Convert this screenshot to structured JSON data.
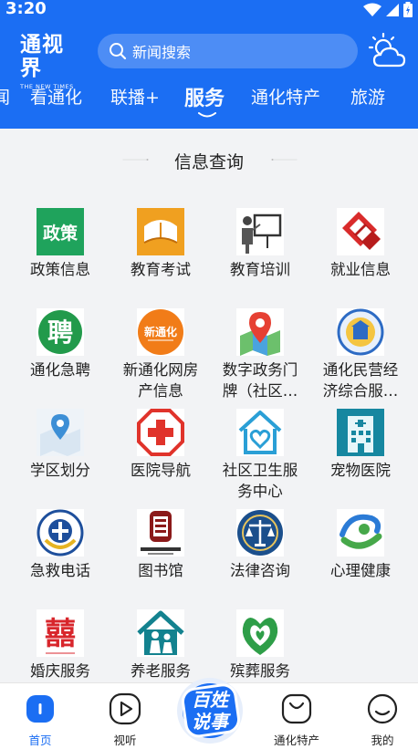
{
  "status": {
    "time": "3:20"
  },
  "header": {
    "logo_main": "通视界",
    "logo_sub": "THE NEW TIMES",
    "search_placeholder": "新闻搜索"
  },
  "tabs": [
    {
      "label": "闻"
    },
    {
      "label": "看通化"
    },
    {
      "label": "联播+"
    },
    {
      "label": "服务"
    },
    {
      "label": "通化特产"
    },
    {
      "label": "旅游"
    }
  ],
  "section": {
    "title": "信息查询"
  },
  "services": [
    {
      "label": "政策信息",
      "icon": "policy-icon"
    },
    {
      "label": "教育考试",
      "icon": "book-icon"
    },
    {
      "label": "教育培训",
      "icon": "teacher-icon"
    },
    {
      "label": "就业信息",
      "icon": "employment-icon"
    },
    {
      "label": "通化急聘",
      "icon": "hiring-icon"
    },
    {
      "label": "新通化网房\n产信息",
      "icon": "real-estate-icon"
    },
    {
      "label": "数字政务门\n牌（社区…",
      "icon": "map-pin-icon"
    },
    {
      "label": "通化民营经\n济综合服…",
      "icon": "economy-icon"
    },
    {
      "label": "学区划分",
      "icon": "school-district-icon"
    },
    {
      "label": "医院导航",
      "icon": "hospital-icon"
    },
    {
      "label": "社区卫生服\n务中心",
      "icon": "community-health-icon"
    },
    {
      "label": "宠物医院",
      "icon": "pet-hospital-icon"
    },
    {
      "label": "急救电话",
      "icon": "emergency-icon"
    },
    {
      "label": "图书馆",
      "icon": "library-icon"
    },
    {
      "label": "法律咨询",
      "icon": "law-icon"
    },
    {
      "label": "心理健康",
      "icon": "mental-health-icon"
    },
    {
      "label": "婚庆服务",
      "icon": "wedding-icon"
    },
    {
      "label": "养老服务",
      "icon": "elderly-care-icon"
    },
    {
      "label": "殡葬服务",
      "icon": "funeral-icon"
    }
  ],
  "bottom_nav": [
    {
      "label": "首页",
      "icon": "home-icon"
    },
    {
      "label": "视听",
      "icon": "play-icon"
    },
    {
      "label": "百姓说事",
      "icon": "baixing-icon"
    },
    {
      "label": "通化特产",
      "icon": "shopping-bag-icon"
    },
    {
      "label": "我的",
      "icon": "profile-icon"
    }
  ],
  "colors": {
    "brand": "#1b6ef3",
    "background": "#f2f3f5"
  }
}
